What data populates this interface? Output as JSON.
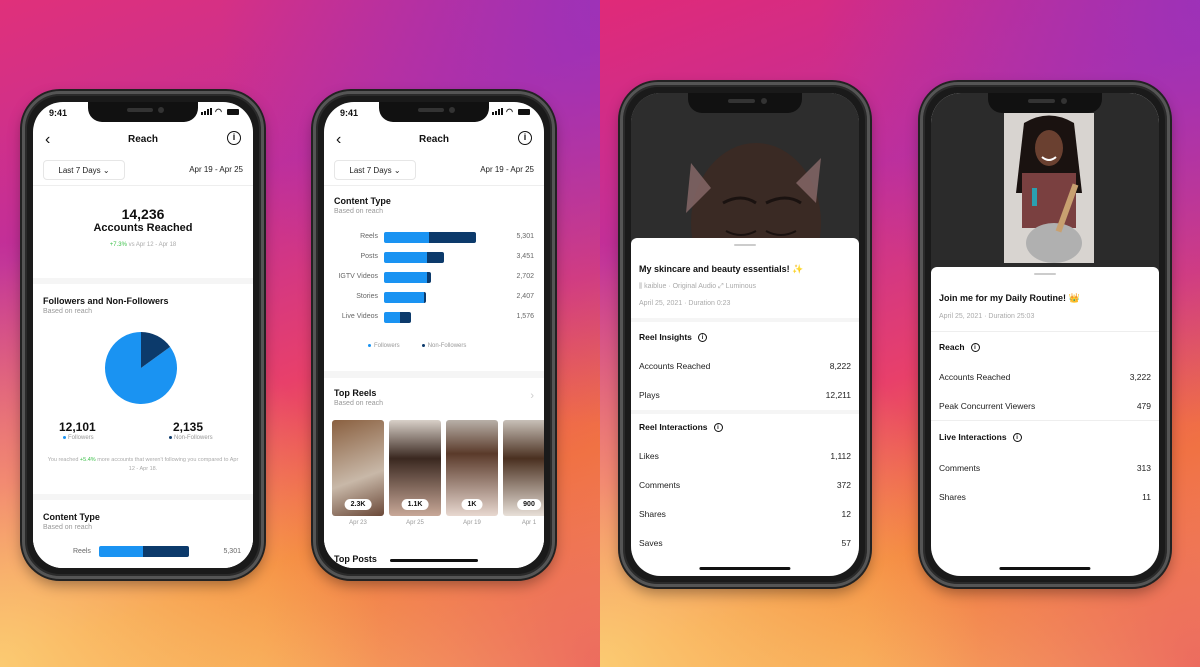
{
  "status_bar": {
    "time": "9:41"
  },
  "reach_header": {
    "title": "Reach",
    "back_icon": "chevron-left-icon",
    "info_icon": "info-icon",
    "range_label": "Last 7 Days",
    "range_icon": "chevron-down-icon",
    "date_range": "Apr 19 - Apr 25"
  },
  "phone1": {
    "accounts_reached_value": "14,236",
    "accounts_reached_label": "Accounts Reached",
    "change_pct": "+7.3%",
    "change_compare": " vs Apr 12 - Apr 18",
    "followers_section": {
      "title": "Followers and Non-Followers",
      "subtitle": "Based on reach",
      "followers_value": "12,101",
      "followers_label": "Followers",
      "non_followers_value": "2,135",
      "non_followers_label": "Non-Followers",
      "note_prefix": "You reached ",
      "note_pct": "+5.4%",
      "note_suffix": " more accounts that weren't following you compared to Apr 12 - Apr 18."
    },
    "content_type": {
      "title": "Content Type",
      "subtitle": "Based on reach",
      "first_row_label": "Reels",
      "first_row_value": "5,301"
    }
  },
  "chart_data": [
    {
      "type": "pie",
      "title": "Followers and Non-Followers",
      "subtitle": "Based on reach",
      "labels": [
        "Followers",
        "Non-Followers"
      ],
      "values": [
        12101,
        2135
      ],
      "colors": [
        "#1a93f2",
        "#0c3a6b"
      ]
    },
    {
      "type": "bar",
      "orientation": "horizontal",
      "stacked": true,
      "title": "Content Type",
      "subtitle": "Based on reach",
      "categories": [
        "Reels",
        "Posts",
        "IGTV Videos",
        "Stories",
        "Live Videos"
      ],
      "totals": [
        5301,
        3451,
        2702,
        2407,
        1576
      ],
      "series": [
        {
          "name": "Followers",
          "color": "#1a93f2",
          "values": [
            2600,
            2450,
            2500,
            2330,
            900
          ]
        },
        {
          "name": "Non-Followers",
          "color": "#0c3a6b",
          "values": [
            2701,
            1001,
            202,
            77,
            676
          ]
        }
      ],
      "legend": "bottom"
    }
  ],
  "phone2": {
    "content_type_title": "Content Type",
    "content_type_subtitle": "Based on reach",
    "bar_labels": [
      "Reels",
      "Posts",
      "IGTV Videos",
      "Stories",
      "Live Videos"
    ],
    "bar_values": [
      "5,301",
      "3,451",
      "2,702",
      "2,407",
      "1,576"
    ],
    "legend_followers": "Followers",
    "legend_non_followers": "Non-Followers",
    "top_reels_title": "Top Reels",
    "top_reels_subtitle": "Based on reach",
    "top_reels": [
      {
        "count": "2.3K",
        "date": "Apr 23"
      },
      {
        "count": "1.1K",
        "date": "Apr 25"
      },
      {
        "count": "1K",
        "date": "Apr 19"
      },
      {
        "count": "900",
        "date": "Apr 1"
      }
    ],
    "top_posts_title": "Top Posts"
  },
  "phone3": {
    "title": "My skincare and beauty essentials! ✨",
    "audio": "kaiblue · Original Audio",
    "effect": "Luminous",
    "date_duration": "April 25, 2021 · Duration 0:23",
    "insights_title": "Reel Insights",
    "insights": [
      {
        "label": "Accounts Reached",
        "value": "8,222"
      },
      {
        "label": "Plays",
        "value": "12,211"
      }
    ],
    "interactions_title": "Reel Interactions",
    "interactions": [
      {
        "label": "Likes",
        "value": "1,112"
      },
      {
        "label": "Comments",
        "value": "372"
      },
      {
        "label": "Shares",
        "value": "12"
      },
      {
        "label": "Saves",
        "value": "57"
      }
    ]
  },
  "phone4": {
    "title": "Join me for my Daily Routine! 👑",
    "date_duration": "April 25, 2021 · Duration 25:03",
    "reach_title": "Reach",
    "reach": [
      {
        "label": "Accounts Reached",
        "value": "3,222"
      },
      {
        "label": "Peak Concurrent Viewers",
        "value": "479"
      }
    ],
    "interactions_title": "Live Interactions",
    "interactions": [
      {
        "label": "Comments",
        "value": "313"
      },
      {
        "label": "Shares",
        "value": "11"
      }
    ]
  }
}
